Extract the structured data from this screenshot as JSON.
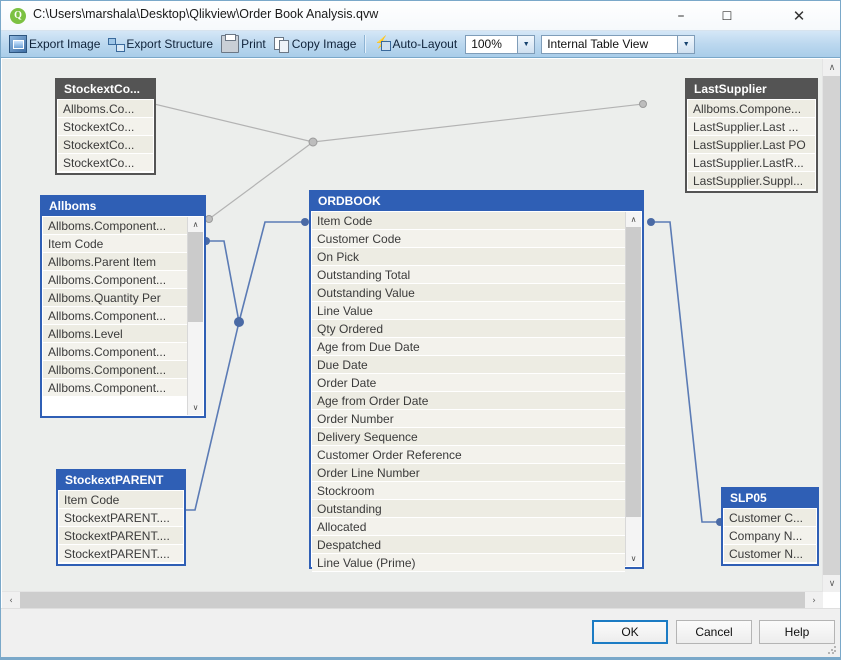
{
  "window": {
    "title": "C:\\Users\\marshala\\Desktop\\Qlikview\\Order Book Analysis.qvw",
    "app_badge": "Q",
    "minimize": "–",
    "maximize": "☐",
    "close": "✕"
  },
  "toolbar": {
    "export_image": "Export Image",
    "export_structure": "Export Structure",
    "print": "Print",
    "copy_image": "Copy Image",
    "auto_layout": "Auto-Layout",
    "zoom_value": "100%",
    "view_value": "Internal Table View",
    "arrow": "▼"
  },
  "scrollbars": {
    "up": "∧",
    "down": "∨",
    "left": "‹",
    "right": "›"
  },
  "tables": [
    {
      "id": "stockextco",
      "name": "StockextCo...",
      "state": "inactive",
      "fields": [
        "Allboms.Co...",
        "StockextCo...",
        "StockextCo...",
        "StockextCo..."
      ]
    },
    {
      "id": "lastsupplier",
      "name": "LastSupplier",
      "state": "inactive",
      "fields": [
        "Allboms.Compone...",
        "LastSupplier.Last ...",
        "LastSupplier.Last PO",
        "LastSupplier.LastR...",
        "LastSupplier.Suppl..."
      ]
    },
    {
      "id": "allboms",
      "name": "Allboms",
      "state": "active",
      "fields": [
        "Allboms.Component...",
        "Item Code",
        "Allboms.Parent Item",
        "Allboms.Component...",
        "Allboms.Quantity Per",
        "Allboms.Component...",
        "Allboms.Level",
        "Allboms.Component...",
        "Allboms.Component...",
        "Allboms.Component..."
      ]
    },
    {
      "id": "ordbook",
      "name": "ORDBOOK",
      "state": "active",
      "fields": [
        "Item Code",
        "Customer Code",
        "On Pick",
        "Outstanding Total",
        "Outstanding Value",
        "Line Value",
        "Qty Ordered",
        "Age from Due Date",
        "Due Date",
        "Order Date",
        "Age from Order Date",
        "Order Number",
        "Delivery Sequence",
        "Customer Order Reference",
        "Order Line Number",
        "Stockroom",
        "Outstanding",
        "Allocated",
        "Despatched",
        "Line Value (Prime)"
      ]
    },
    {
      "id": "stockextparent",
      "name": "StockextPARENT",
      "state": "active",
      "fields": [
        "Item Code",
        "StockextPARENT....",
        "StockextPARENT....",
        "StockextPARENT...."
      ]
    },
    {
      "id": "slp05",
      "name": "SLP05",
      "state": "active",
      "fields": [
        "Customer C...",
        "Company N...",
        "Customer N..."
      ]
    }
  ],
  "footer": {
    "ok": "OK",
    "cancel": "Cancel",
    "help": "Help"
  },
  "colors": {
    "active_title": "#2f5fb5",
    "inactive_title": "#545454",
    "toolbar": "#bcd8ef",
    "canvas": "#eceeec",
    "link_grey": "#b3b3b3",
    "link_blue": "#5b7bb5",
    "focus_blue": "#1c7cc4"
  }
}
